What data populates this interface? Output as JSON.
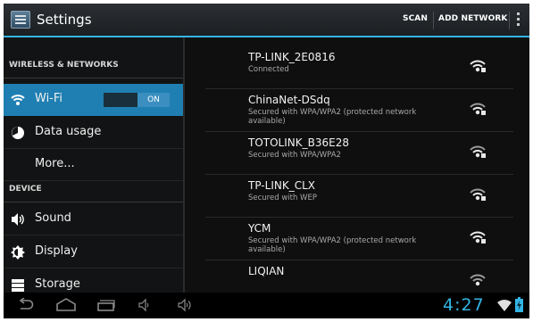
{
  "action_bar": {
    "title": "Settings",
    "scan_label": "SCAN",
    "add_network_label": "ADD NETWORK",
    "app_icon": "settings-app-icon",
    "overflow_icon": "overflow-menu-icon"
  },
  "sidebar": {
    "sections": [
      {
        "header": "WIRELESS & NETWORKS"
      },
      {
        "header": "DEVICE"
      }
    ],
    "items": [
      {
        "label": "Wi-Fi",
        "icon": "wifi-icon",
        "selected": true,
        "toggle": "ON"
      },
      {
        "label": "Data usage",
        "icon": "data-usage-icon"
      },
      {
        "label": "More..."
      },
      {
        "label": "Sound",
        "icon": "speaker-icon"
      },
      {
        "label": "Display",
        "icon": "brightness-icon"
      },
      {
        "label": "Storage",
        "icon": "storage-icon"
      }
    ]
  },
  "networks": [
    {
      "ssid": "TP-LINK_2E0816",
      "status": "Connected",
      "secured": true
    },
    {
      "ssid": "ChinaNet-DSdq",
      "status": "Secured with WPA/WPA2 (protected network available)",
      "secured": true
    },
    {
      "ssid": "TOTOLINK_B36E28",
      "status": "Secured with WPA/WPA2",
      "secured": true
    },
    {
      "ssid": "TP-LINK_CLX",
      "status": "Secured with WEP",
      "secured": true
    },
    {
      "ssid": "YCM",
      "status": "Secured with WPA/WPA2 (protected network available)",
      "secured": true
    },
    {
      "ssid": "LIQIAN",
      "status": "",
      "secured": true
    }
  ],
  "nav_bar": {
    "icons": [
      "back-icon",
      "home-icon",
      "recent-apps-icon",
      "volume-down-icon",
      "volume-up-icon"
    ],
    "clock": "4:27",
    "status_icons": [
      "wifi-status-icon",
      "battery-icon"
    ]
  },
  "colors": {
    "accent": "#33b5e5",
    "selected_item": "#1f7fb2"
  }
}
